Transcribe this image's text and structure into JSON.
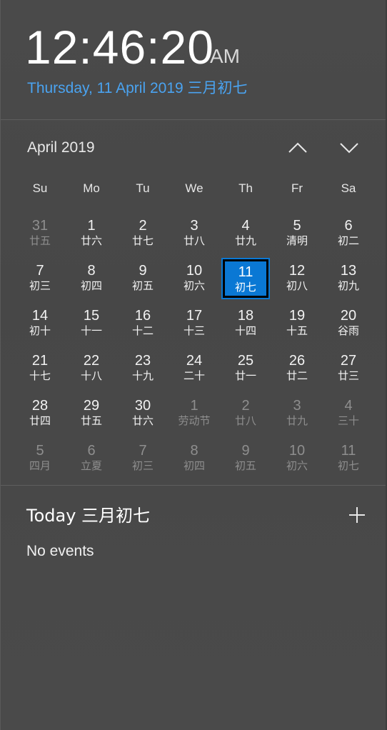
{
  "clock": {
    "time": "12:46:20",
    "ampm": "AM",
    "date_line": "Thursday, 11 April 2019 三月初七"
  },
  "calendar": {
    "month_label": "April 2019",
    "prev_icon": "chevron-up-icon",
    "next_icon": "chevron-down-icon",
    "weekdays": [
      "Su",
      "Mo",
      "Tu",
      "We",
      "Th",
      "Fr",
      "Sa"
    ],
    "weeks": [
      [
        {
          "day": "31",
          "lunar": "廿五",
          "state": "dim"
        },
        {
          "day": "1",
          "lunar": "廿六",
          "state": "cur"
        },
        {
          "day": "2",
          "lunar": "廿七",
          "state": "cur"
        },
        {
          "day": "3",
          "lunar": "廿八",
          "state": "cur"
        },
        {
          "day": "4",
          "lunar": "廿九",
          "state": "cur"
        },
        {
          "day": "5",
          "lunar": "清明",
          "state": "cur"
        },
        {
          "day": "6",
          "lunar": "初二",
          "state": "cur"
        }
      ],
      [
        {
          "day": "7",
          "lunar": "初三",
          "state": "cur"
        },
        {
          "day": "8",
          "lunar": "初四",
          "state": "cur"
        },
        {
          "day": "9",
          "lunar": "初五",
          "state": "cur"
        },
        {
          "day": "10",
          "lunar": "初六",
          "state": "cur"
        },
        {
          "day": "11",
          "lunar": "初七",
          "state": "today"
        },
        {
          "day": "12",
          "lunar": "初八",
          "state": "cur"
        },
        {
          "day": "13",
          "lunar": "初九",
          "state": "cur"
        }
      ],
      [
        {
          "day": "14",
          "lunar": "初十",
          "state": "cur"
        },
        {
          "day": "15",
          "lunar": "十一",
          "state": "cur"
        },
        {
          "day": "16",
          "lunar": "十二",
          "state": "cur"
        },
        {
          "day": "17",
          "lunar": "十三",
          "state": "cur"
        },
        {
          "day": "18",
          "lunar": "十四",
          "state": "cur"
        },
        {
          "day": "19",
          "lunar": "十五",
          "state": "cur"
        },
        {
          "day": "20",
          "lunar": "谷雨",
          "state": "cur"
        }
      ],
      [
        {
          "day": "21",
          "lunar": "十七",
          "state": "cur"
        },
        {
          "day": "22",
          "lunar": "十八",
          "state": "cur"
        },
        {
          "day": "23",
          "lunar": "十九",
          "state": "cur"
        },
        {
          "day": "24",
          "lunar": "二十",
          "state": "cur"
        },
        {
          "day": "25",
          "lunar": "廿一",
          "state": "cur"
        },
        {
          "day": "26",
          "lunar": "廿二",
          "state": "cur"
        },
        {
          "day": "27",
          "lunar": "廿三",
          "state": "cur"
        }
      ],
      [
        {
          "day": "28",
          "lunar": "廿四",
          "state": "cur"
        },
        {
          "day": "29",
          "lunar": "廿五",
          "state": "cur"
        },
        {
          "day": "30",
          "lunar": "廿六",
          "state": "cur"
        },
        {
          "day": "1",
          "lunar": "劳动节",
          "state": "dim"
        },
        {
          "day": "2",
          "lunar": "廿八",
          "state": "dim"
        },
        {
          "day": "3",
          "lunar": "廿九",
          "state": "dim"
        },
        {
          "day": "4",
          "lunar": "三十",
          "state": "dim"
        }
      ],
      [
        {
          "day": "5",
          "lunar": "四月",
          "state": "dim"
        },
        {
          "day": "6",
          "lunar": "立夏",
          "state": "dim"
        },
        {
          "day": "7",
          "lunar": "初三",
          "state": "dim"
        },
        {
          "day": "8",
          "lunar": "初四",
          "state": "dim"
        },
        {
          "day": "9",
          "lunar": "初五",
          "state": "dim"
        },
        {
          "day": "10",
          "lunar": "初六",
          "state": "dim"
        },
        {
          "day": "11",
          "lunar": "初七",
          "state": "dim"
        }
      ]
    ]
  },
  "agenda": {
    "title": "Today 三月初七",
    "add_icon": "plus-icon",
    "empty_text": "No events"
  },
  "colors": {
    "accent": "#0a78d4",
    "link": "#4aa3f0",
    "background": "#484848"
  }
}
